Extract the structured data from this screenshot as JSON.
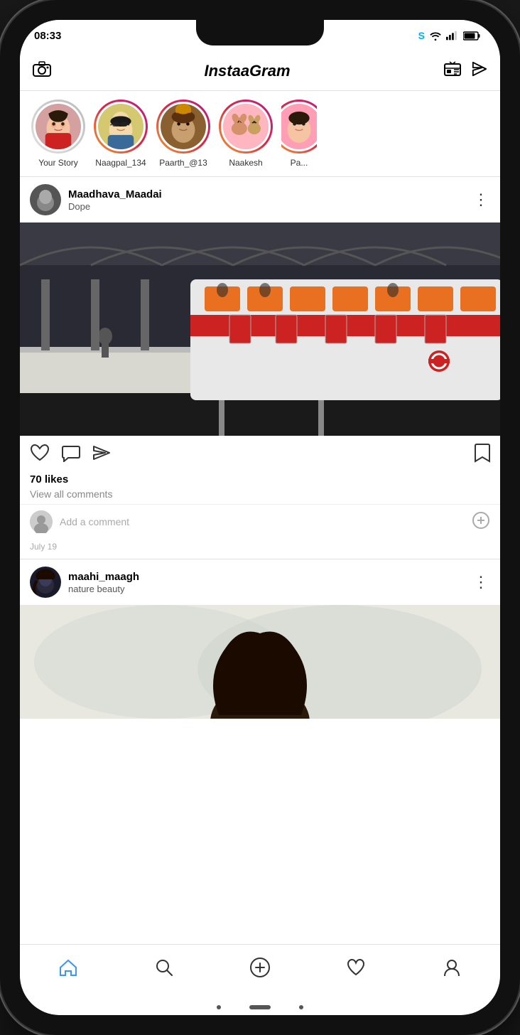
{
  "status": {
    "time": "08:33",
    "skype_icon": "S",
    "wifi": "📶",
    "signal": "📶",
    "battery": "🔋"
  },
  "header": {
    "camera_icon": "📷",
    "brand": "InstaaGram",
    "tv_icon": "📺",
    "send_icon": "✈"
  },
  "stories": [
    {
      "id": "your-story",
      "label": "Your Story",
      "color": "gradient-gray",
      "avatar": "👤"
    },
    {
      "id": "naagpal",
      "label": "Naagpal_134",
      "color": "gradient-red",
      "avatar": "🕶"
    },
    {
      "id": "paarth",
      "label": "Paarth_@13",
      "color": "gradient-red",
      "avatar": "🌟"
    },
    {
      "id": "naakesh",
      "label": "Naakesh",
      "color": "gradient-red",
      "avatar": "🐕"
    },
    {
      "id": "pa",
      "label": "Pa...",
      "color": "gradient-red",
      "avatar": "🌸"
    }
  ],
  "post1": {
    "username": "Maadhava_Maadai",
    "subtitle": "Dope",
    "menu": "⋮",
    "likes": "70 likes",
    "view_comments": "View all comments",
    "add_comment_placeholder": "Add a comment",
    "date": "July 19",
    "bookmark_icon": "🔖",
    "like_icon": "♡",
    "comment_icon": "💬",
    "share_icon": "✈"
  },
  "post2": {
    "username": "maahi_maagh",
    "subtitle": "nature beauty",
    "menu": "⋮"
  },
  "bottomNav": {
    "home_label": "home",
    "search_label": "search",
    "add_label": "add",
    "heart_label": "heart",
    "profile_label": "profile"
  }
}
